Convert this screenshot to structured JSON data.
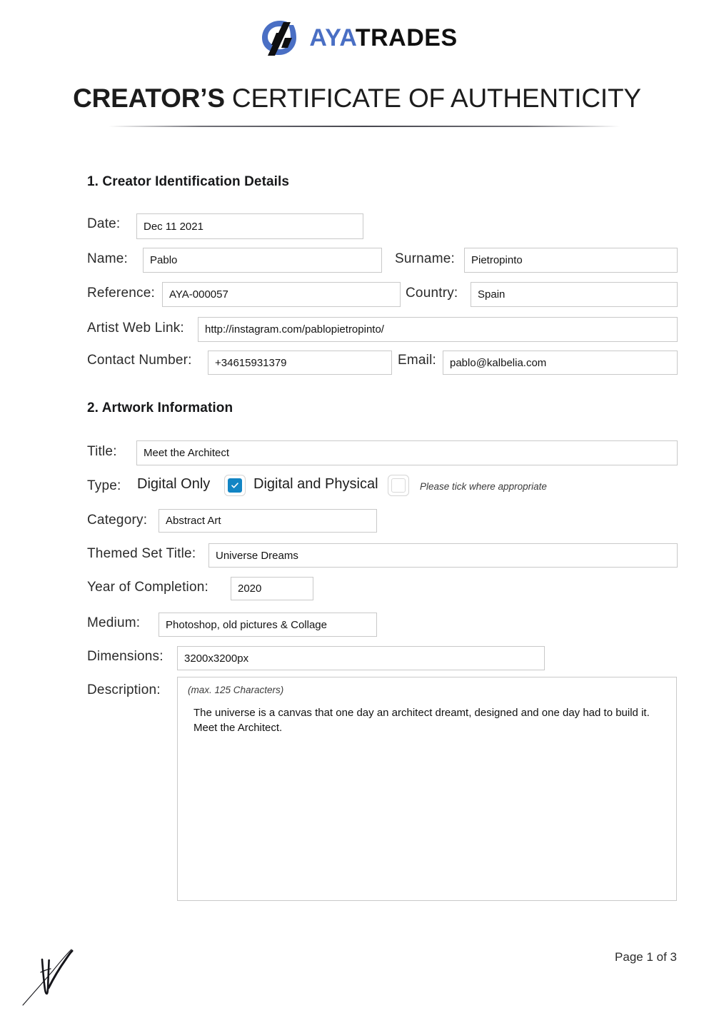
{
  "brand": {
    "logo_icon": "ayatrades-logo-mark",
    "name_primary": "AYA",
    "name_secondary": "TRADES",
    "primary_color": "#4a6fc4",
    "secondary_color": "#101010"
  },
  "document": {
    "title_bold": "CREATOR’S",
    "title_light": "CERTIFICATE OF AUTHENTICITY"
  },
  "section1": {
    "heading": "1. Creator Identification Details",
    "fields": {
      "date_label": "Date:",
      "date_value": "Dec 11 2021",
      "name_label": "Name:",
      "name_value": "Pablo",
      "surname_label": "Surname:",
      "surname_value": "Pietropinto",
      "reference_label": "Reference:",
      "reference_value": "AYA-000057",
      "country_label": "Country:",
      "country_value": "Spain",
      "weblink_label": "Artist Web Link:",
      "weblink_value": "http://instagram.com/pablopietropinto/",
      "contact_label": "Contact Number:",
      "contact_value": "+34615931379",
      "email_label": "Email:",
      "email_value": "pablo@kalbelia.com"
    }
  },
  "section2": {
    "heading": "2. Artwork Information",
    "fields": {
      "title_label": "Title:",
      "title_value": "Meet the Architect",
      "type_label": "Type:",
      "type_option_digital_only": "Digital Only",
      "type_option_digital_physical": "Digital and Physical",
      "type_hint": "Please tick where appropriate",
      "category_label": "Category:",
      "category_value": "Abstract Art",
      "themed_set_label": "Themed Set Title:",
      "themed_set_value": "Universe Dreams",
      "year_label": "Year of Completion:",
      "year_value": "2020",
      "medium_label": "Medium:",
      "medium_value": "Photoshop, old pictures & Collage",
      "dimensions_label": "Dimensions:",
      "dimensions_value": "3200x3200px",
      "description_label": "Description:",
      "description_hint": "(max. 125 Characters)",
      "description_value": "The universe is a canvas that one day an architect dreamt, designed and one day had to build it. Meet the Architect."
    },
    "checkbox_states": {
      "digital_only_checked": true,
      "digital_and_physical_checked": false,
      "checked_color": "#1285c4"
    }
  },
  "footer": {
    "signature_icon": "handwritten-signature",
    "page_label": "Page 1 of 3"
  }
}
